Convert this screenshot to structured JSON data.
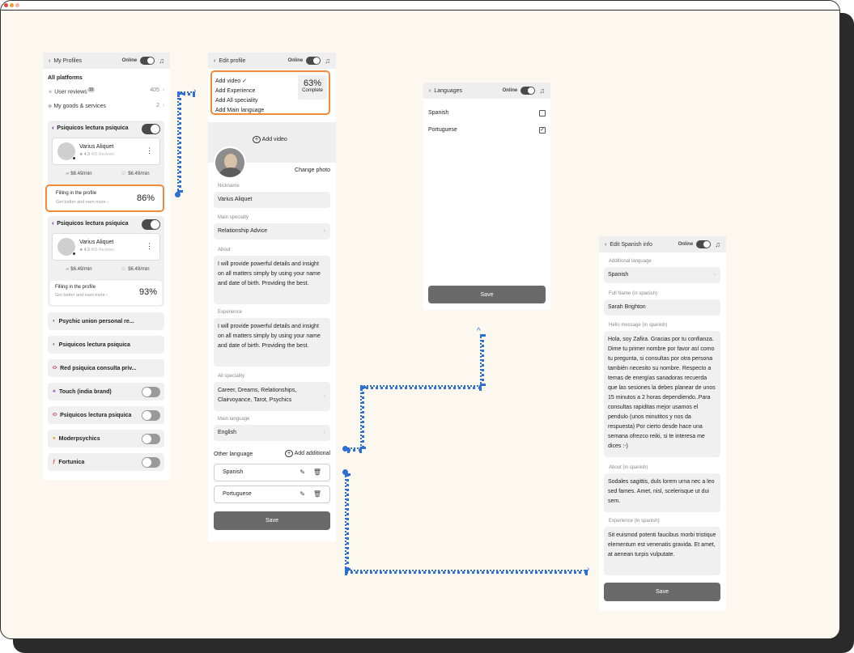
{
  "p1": {
    "header": {
      "title": "My Profiles",
      "online": "Online"
    },
    "all_platforms": "All platforms",
    "user_reviews": {
      "label": "User reviews",
      "badge": "10",
      "count": "405"
    },
    "goods": {
      "label": "My goods & services",
      "count": "2"
    },
    "profile_cards": [
      {
        "title": "Psiquicos lectura psiquica",
        "name": "Varius Aliquet",
        "rating": "4.3",
        "reviews": "405 Reviews",
        "chat_price": "$6.49/min",
        "call_price": "$6.49/min",
        "fill_title": "Filling in the profile",
        "fill_sub": "Get better and earn more",
        "fill_percent": "86%"
      },
      {
        "title": "Psiquicos lectura psiquica",
        "name": "Varius Aliquet",
        "rating": "4.3",
        "reviews": "405 Reviews",
        "chat_price": "$6.49/min",
        "call_price": "$6.49/min",
        "fill_title": "Filling in the profile",
        "fill_sub": "Get better and earn more",
        "fill_percent": "93%"
      }
    ],
    "platforms": [
      {
        "label": "Psychic union personal re...",
        "toggle": "none"
      },
      {
        "label": "Psiquicos lectura psiquica",
        "toggle": "none"
      },
      {
        "label": "Red psiquica consulta priv...",
        "toggle": "none"
      },
      {
        "label": "Touch (india brand)",
        "toggle": "off"
      },
      {
        "label": "Psiquicos lectura psiquica",
        "toggle": "off"
      },
      {
        "label": "Moderpsychics",
        "toggle": "off"
      },
      {
        "label": "Fortunica",
        "toggle": "off"
      }
    ]
  },
  "p2": {
    "header": {
      "title": "Edit profile",
      "online": "Online"
    },
    "checklist": [
      "Add video ✓",
      "Add Experience",
      "Add All speciality",
      "Add Main language"
    ],
    "complete_percent": "63%",
    "complete_label": "Complete",
    "add_video": "Add video",
    "change_photo": "Change photo",
    "nickname_label": "Nickname",
    "nickname": "Varius Aliquet",
    "main_specialty_label": "Main specialty",
    "main_specialty": "Relationship Advice",
    "about_label": "About",
    "about": "I will provide powerful details and insight on all matters simply by using your name and date of birth. Providing the best.",
    "experience_label": "Experience",
    "experience": "I will provide powerful details and insight on all matters simply by using your name and date of birth. Providing the best.",
    "all_speciality_label": "All speciality",
    "all_speciality": "Career, Dreams, Relationships, Clairvoyance, Tarot, Psychics",
    "main_language_label": "Main language",
    "main_language": "English",
    "other_language_label": "Other language",
    "add_additional": "Add additional",
    "other_languages": [
      "Spanish",
      "Portuguese"
    ],
    "save": "Save"
  },
  "p3": {
    "header": {
      "title": "Languages",
      "online": "Online"
    },
    "languages": [
      {
        "label": "Spanish",
        "checked": false
      },
      {
        "label": "Portuguese",
        "checked": true
      }
    ],
    "save": "Save"
  },
  "p4": {
    "header": {
      "title": "Edit Spanish info",
      "online": "Online"
    },
    "additional_language_label": "Additional language",
    "additional_language": "Spanish",
    "full_name_label": "Full Name (in spanish)",
    "full_name": "Sarah Brighton",
    "hello_label": "Hello message (in spanish)",
    "hello": "Hola, soy Zafira. Gracias por tu confianza. Dime tu primer nombre por favor así como tu pregunta, si consultas por otra persona también necesito su nombre. Respecto a temas de energías sanadoras recuerda que las sesiones la debes planear de unos 15 minutos a 2 horas dependiendo..Para consultas rapiditas mejor usamos el pendulo (unos minutitos y nos da respuesta) Por cierto desde hace una semana ofrezco reiki, si te interesa me dices :-)",
    "about_label": "About (in spanish)",
    "about": "Sodales sagittis, duls lorem urna nec a leo sed fames. Amet, nisl, scelerisque ut dui sem.",
    "experience_label": "Experience (in spanish)",
    "experience": "Sit euismod potenti faucibus morbi tristique elementum est venenatis gravida. Et amet, at aenean turpis vulputate.",
    "save": "Save"
  },
  "colors": {
    "accent_orange": "#f08a3c",
    "connector_blue": "#2d6fd6",
    "save_button": "#6a6a6a",
    "background": "#fdf8ef"
  }
}
